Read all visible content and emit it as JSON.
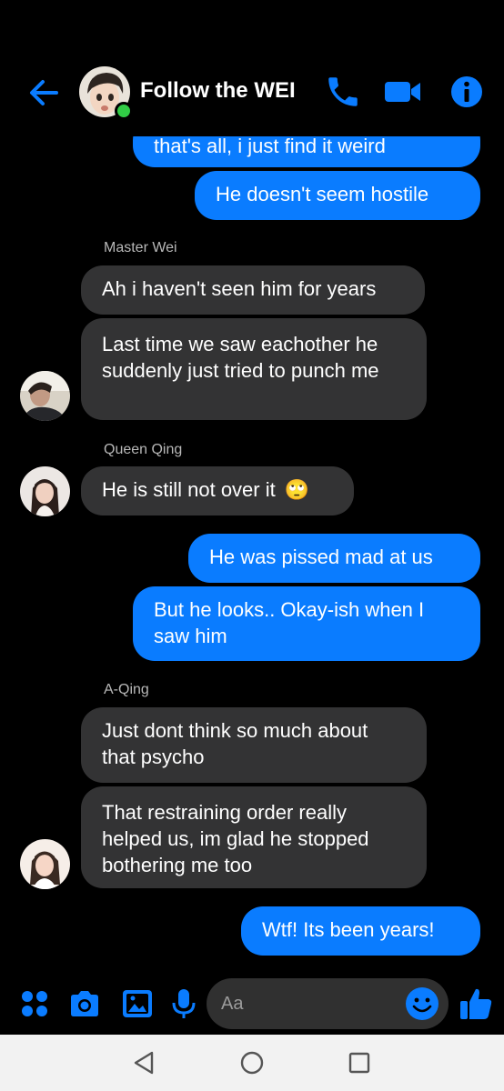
{
  "header": {
    "title": "Follow the WEI",
    "icons": [
      "back-arrow-icon",
      "phone-icon",
      "video-camera-icon",
      "info-icon"
    ]
  },
  "messages": [
    {
      "direction": "out",
      "text": "that's all, i just find it weird"
    },
    {
      "direction": "out",
      "text": "He doesn't seem hostile"
    },
    {
      "sender": "Master Wei",
      "direction": "in",
      "text": "Ah i haven't seen him for years"
    },
    {
      "direction": "in",
      "text": "Last time we saw eachother he suddenly just tried to punch me"
    },
    {
      "sender": "Queen Qing",
      "direction": "in",
      "text": "He is still not over it",
      "emoji": "🙄"
    },
    {
      "direction": "out",
      "text": "He was pissed mad at us"
    },
    {
      "direction": "out",
      "text": "But he looks.. Okay-ish when I saw him"
    },
    {
      "sender": "A-Qing",
      "direction": "in",
      "text": "Just dont think so much about that psycho"
    },
    {
      "direction": "in",
      "text": "That restraining order really helped us, im glad he stopped bothering me too"
    },
    {
      "direction": "out",
      "text": "Wtf! Its been years!"
    }
  ],
  "composer": {
    "placeholder": "Aa",
    "icons": [
      "apps-icon",
      "camera-icon",
      "gallery-icon",
      "microphone-icon",
      "emoji-icon",
      "thumbs-up-icon"
    ]
  },
  "navbar": {
    "icons": [
      "nav-back-icon",
      "nav-home-icon",
      "nav-recents-icon"
    ]
  },
  "colors": {
    "accent": "#0a7cff",
    "incoming_bubble": "#333334",
    "online": "#31cc46",
    "background": "#000000"
  }
}
